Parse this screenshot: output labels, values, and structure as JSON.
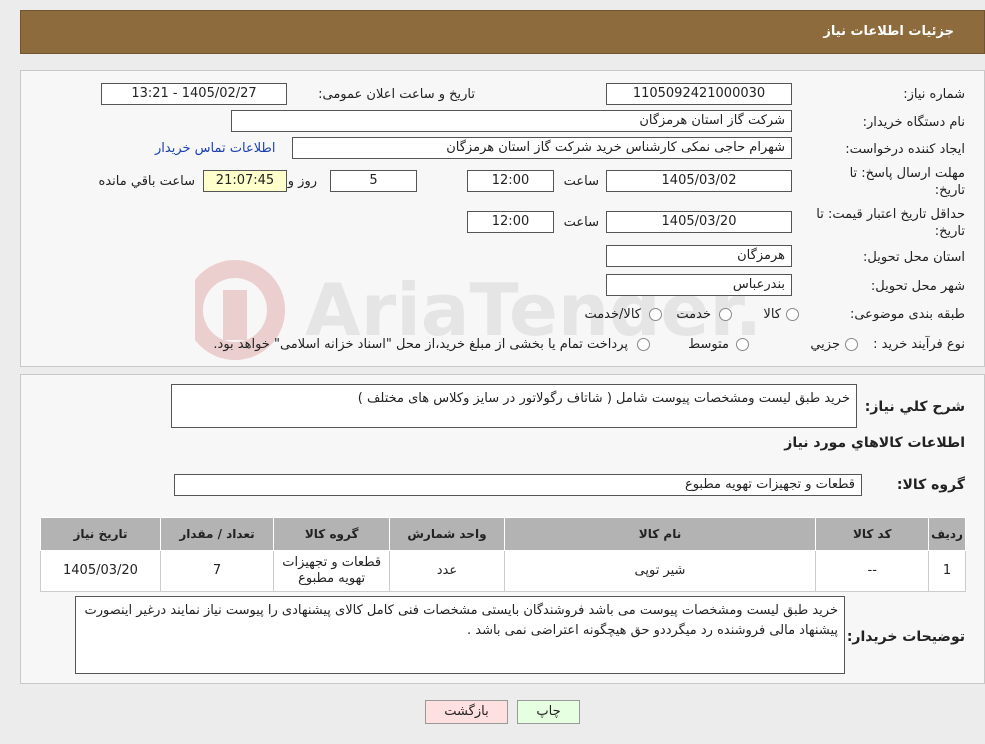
{
  "header": {
    "title": "جزئیات اطلاعات نیاز"
  },
  "watermark": {
    "text": "AriaTender.neT"
  },
  "info": {
    "need_number_label": "شماره نیاز:",
    "need_number": "1105092421000030",
    "announce_label": "تاریخ و ساعت اعلان عمومی:",
    "announce_value": "1405/02/27 - 13:21",
    "buyer_org_label": "نام دستگاه خریدار:",
    "buyer_org": "شرکت گاز استان هرمزگان",
    "creator_label": "ایجاد کننده درخواست:",
    "creator": "شهرام حاجی نمکی کارشناس خرید شرکت گاز استان هرمزگان",
    "contact_link": "اطلاعات تماس خریدار",
    "deadline_label_1": "مهلت ارسال پاسخ: تا",
    "deadline_label_2": "تاریخ:",
    "deadline_date": "1405/03/02",
    "time_label": "ساعت",
    "deadline_time": "12:00",
    "days_value": "5",
    "days_label": "روز و",
    "remaining_time": "21:07:45",
    "remaining_label": "ساعت باقي مانده",
    "validity_label_1": "حداقل تاریخ اعتبار قیمت: تا",
    "validity_label_2": "تاریخ:",
    "validity_date": "1405/03/20",
    "validity_time": "12:00",
    "province_label": "استان محل تحویل:",
    "province": "هرمزگان",
    "city_label": "شهر محل تحویل:",
    "city": "بندرعباس",
    "category_label": "طبقه بندی موضوعی:",
    "category_options": [
      "کالا",
      "خدمت",
      "کالا/خدمت"
    ],
    "process_label": "نوع فرآیند خرید :",
    "process_options": [
      "جزیي",
      "متوسط"
    ],
    "process_note": "پرداخت تمام یا بخشی از مبلغ خرید،از محل \"اسناد خزانه اسلامی\" خواهد بود."
  },
  "details": {
    "desc_label": "شرح كلي نياز:",
    "desc_value": "خرید طبق لیست ومشخصات پیوست شامل ( شاتاف رگولاتور در سایز وکلاس های مختلف )",
    "goods_info_title": "اطلاعات كالاهاي مورد نياز",
    "goods_group_label": "گروه كالا:",
    "goods_group": "قطعات و تجهیزات تهویه مطبوع",
    "table": {
      "headers": [
        "رديف",
        "كد كالا",
        "نام كالا",
        "واحد شمارش",
        "گروه كالا",
        "تعداد / مقدار",
        "تاريخ نياز"
      ],
      "rows": [
        [
          "1",
          "--",
          "شیر توپی",
          "عدد",
          "قطعات و تجهیزات تهویه مطبوع",
          "7",
          "1405/03/20"
        ]
      ]
    },
    "buyer_notes_label": "توضیحات خریدار:",
    "buyer_notes": "خرید طبق لیست ومشخصات پیوست می باشد فروشندگان بایستی مشخصات فنی کامل کالای پیشنهادی را پیوست نیاز نمایند درغیر اینصورت پیشنهاد مالی فروشنده رد میگرددو حق هیچگونه اعتراضی نمی باشد ."
  },
  "buttons": {
    "print": "چاپ",
    "back": "بازگشت"
  },
  "colors": {
    "header": "#8e6b3c",
    "table_header": "#b3b3b3",
    "remaining_bg": "#ffffcc",
    "back_bg": "#ffe0e0",
    "print_bg": "#e6ffe0",
    "link": "#1a3fb5"
  }
}
